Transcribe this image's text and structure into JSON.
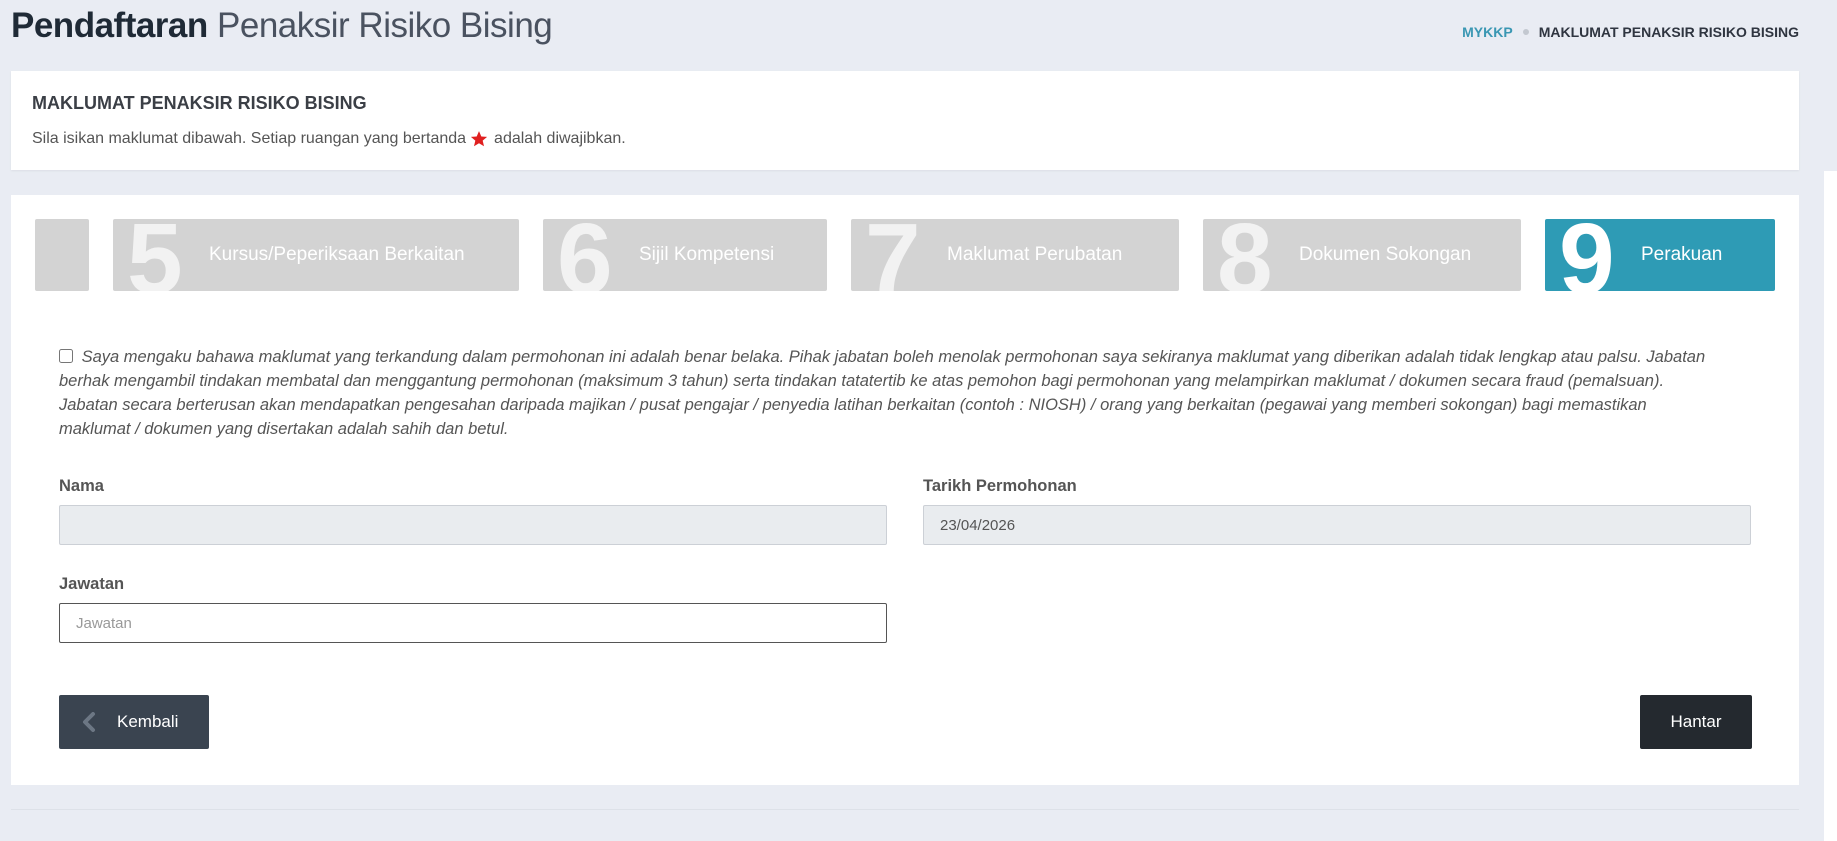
{
  "header": {
    "title_bold": "Pendaftaran",
    "title_light": "Penaksir Risiko Bising",
    "breadcrumb": {
      "home": "MYKKP",
      "current": "MAKLUMAT PENAKSIR RISIKO BISING"
    }
  },
  "info": {
    "heading": "MAKLUMAT PENAKSIR RISIKO BISING",
    "instruction_before": "Sila isikan maklumat dibawah. Setiap ruangan yang bertanda",
    "instruction_after": "adalah diwajibkan.",
    "required_color": "#e02020"
  },
  "steps": [
    {
      "number": "",
      "label": ""
    },
    {
      "number": "5",
      "label": "Kursus/Peperiksaan Berkaitan"
    },
    {
      "number": "6",
      "label": "Sijil Kompetensi"
    },
    {
      "number": "7",
      "label": "Maklumat Perubatan"
    },
    {
      "number": "8",
      "label": "Dokumen Sokongan"
    },
    {
      "number": "9",
      "label": "Perakuan",
      "active": true
    }
  ],
  "declaration": {
    "checked": false,
    "text": "Saya mengaku bahawa maklumat yang terkandung dalam permohonan ini adalah benar belaka. Pihak jabatan boleh menolak permohonan saya sekiranya maklumat yang diberikan adalah tidak lengkap atau palsu. Jabatan berhak mengambil tindakan membatal dan menggantung permohonan (maksimum 3 tahun) serta tindakan tatatertib ke atas pemohon bagi permohonan yang melampirkan maklumat / dokumen secara fraud (pemalsuan). Jabatan secara berterusan akan mendapatkan pengesahan daripada majikan / pusat pengajar / penyedia latihan berkaitan (contoh : NIOSH) / orang yang berkaitan (pegawai yang memberi sokongan) bagi memastikan maklumat / dokumen yang disertakan adalah sahih dan betul."
  },
  "form": {
    "nama_label": "Nama",
    "nama_value": "",
    "tarikh_label": "Tarikh Permohonan",
    "tarikh_value": "23/04/2026",
    "jawatan_label": "Jawatan",
    "jawatan_value": "",
    "jawatan_placeholder": "Jawatan"
  },
  "buttons": {
    "back_label": "Kembali",
    "submit_label": "Hantar"
  },
  "colors": {
    "accent": "#2e9bb5",
    "link": "#3a97b3",
    "back_button": "#3a4450",
    "submit_button": "#24292f"
  }
}
